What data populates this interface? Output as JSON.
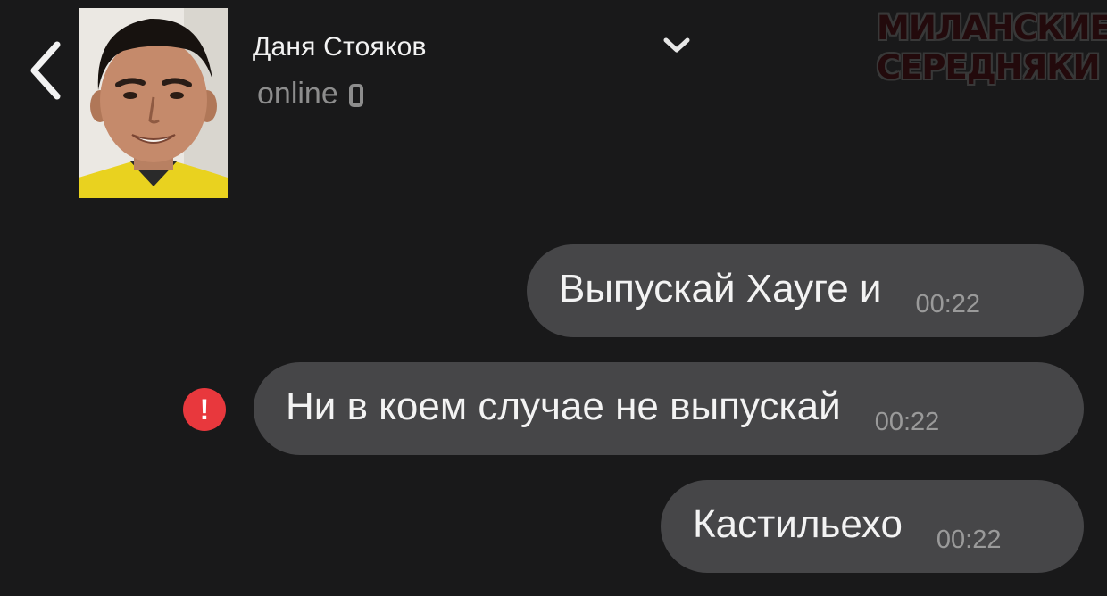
{
  "header": {
    "contact_name": "Даня Стояков",
    "status": "online",
    "back_icon": "chevron-left-icon",
    "menu_icon": "chevron-down-icon",
    "device_icon": "phone-icon"
  },
  "watermark": {
    "line1": "МИЛАНСКИЕ",
    "line2": "СЕРЕДНЯКИ"
  },
  "messages": [
    {
      "text": "Выпускай Хауге и",
      "time": "00:22",
      "failed": false
    },
    {
      "text": "Ни в коем случае не выпускай",
      "time": "00:22",
      "failed": true
    },
    {
      "text": "Кастильехо",
      "time": "00:22",
      "failed": false
    }
  ],
  "colors": {
    "background": "#19191a",
    "bubble": "#464648",
    "error": "#e8383d",
    "status_gray": "#8d8d8d"
  }
}
